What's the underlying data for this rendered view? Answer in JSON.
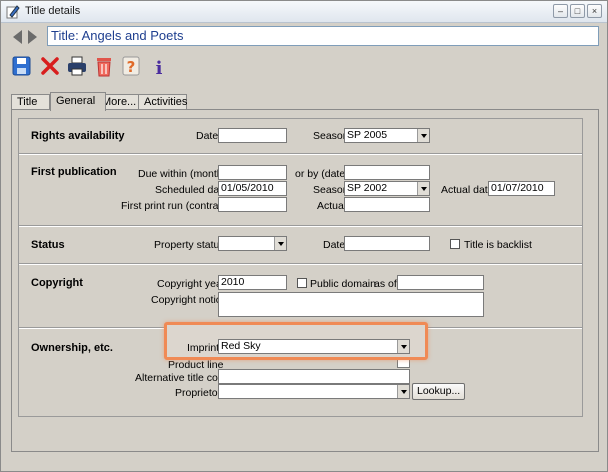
{
  "window": {
    "title": "Title details"
  },
  "header": {
    "title_value": "Title: Angels and Poets"
  },
  "toolbar": {
    "icons": [
      "save-icon",
      "delete-icon",
      "print-icon",
      "trash-icon",
      "help-icon",
      "info-icon"
    ]
  },
  "tabs": [
    {
      "label": "Title"
    },
    {
      "label": "General"
    },
    {
      "label": "More..."
    },
    {
      "label": "Activities"
    }
  ],
  "rights": {
    "section": "Rights availability",
    "date_label": "Date",
    "date_value": "",
    "season_label": "Season",
    "season_value": "SP 2005"
  },
  "first_pub": {
    "section": "First publication",
    "due_label": "Due within (months)",
    "due_value": "",
    "orby_label": "or by (date)",
    "orby_value": "",
    "scheduled_label": "Scheduled date",
    "scheduled_value": "01/05/2010",
    "season_label": "Season",
    "season_value": "SP 2002",
    "actual_date_label": "Actual date",
    "actual_date_value": "01/07/2010",
    "print_run_label": "First print run (contract)",
    "print_run_value": "",
    "actual_label": "Actual",
    "actual_value": ""
  },
  "status": {
    "section": "Status",
    "property_label": "Property status",
    "property_value": "",
    "date_label": "Date",
    "date_value": "",
    "backlist_label": "Title is backlist"
  },
  "copyright": {
    "section": "Copyright",
    "year_label": "Copyright year",
    "year_value": "2010",
    "public_domain_label": "Public domain",
    "asof_label": "as of",
    "asof_value": "",
    "notice_label": "Copyright notice",
    "notice_value": ""
  },
  "ownership": {
    "section": "Ownership, etc.",
    "imprint_label": "Imprint",
    "imprint_value": "Red Sky",
    "product_line_label": "Product line",
    "alt_code_label": "Alternative title code",
    "alt_code_value": "",
    "proprietor_label": "Proprietor",
    "proprietor_value": "",
    "lookup_label": "Lookup..."
  },
  "colors": {
    "highlight": "#f08a55",
    "title_text": "#1f3f8f",
    "panel": "#d4d0c8"
  }
}
